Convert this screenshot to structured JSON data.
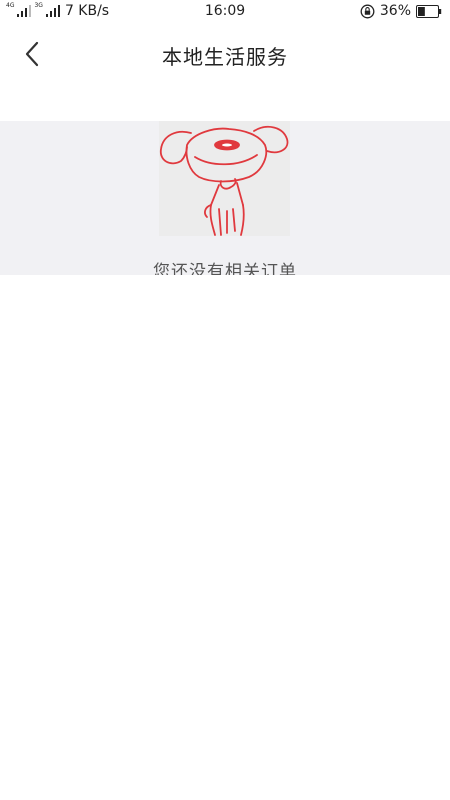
{
  "status_bar": {
    "network_small_top": "4G",
    "network_small_second": "3G",
    "speed": "7 KB/s",
    "time": "16:09",
    "battery_percent": "36%",
    "battery_level": 0.36
  },
  "header": {
    "title": "本地生活服务",
    "back_icon": "chevron-left-icon"
  },
  "empty_state": {
    "message": "您还没有相关订单",
    "illustration": "jd-dog-mascot",
    "band_color": "#f1f1f4",
    "line_color": "#e0393e"
  }
}
